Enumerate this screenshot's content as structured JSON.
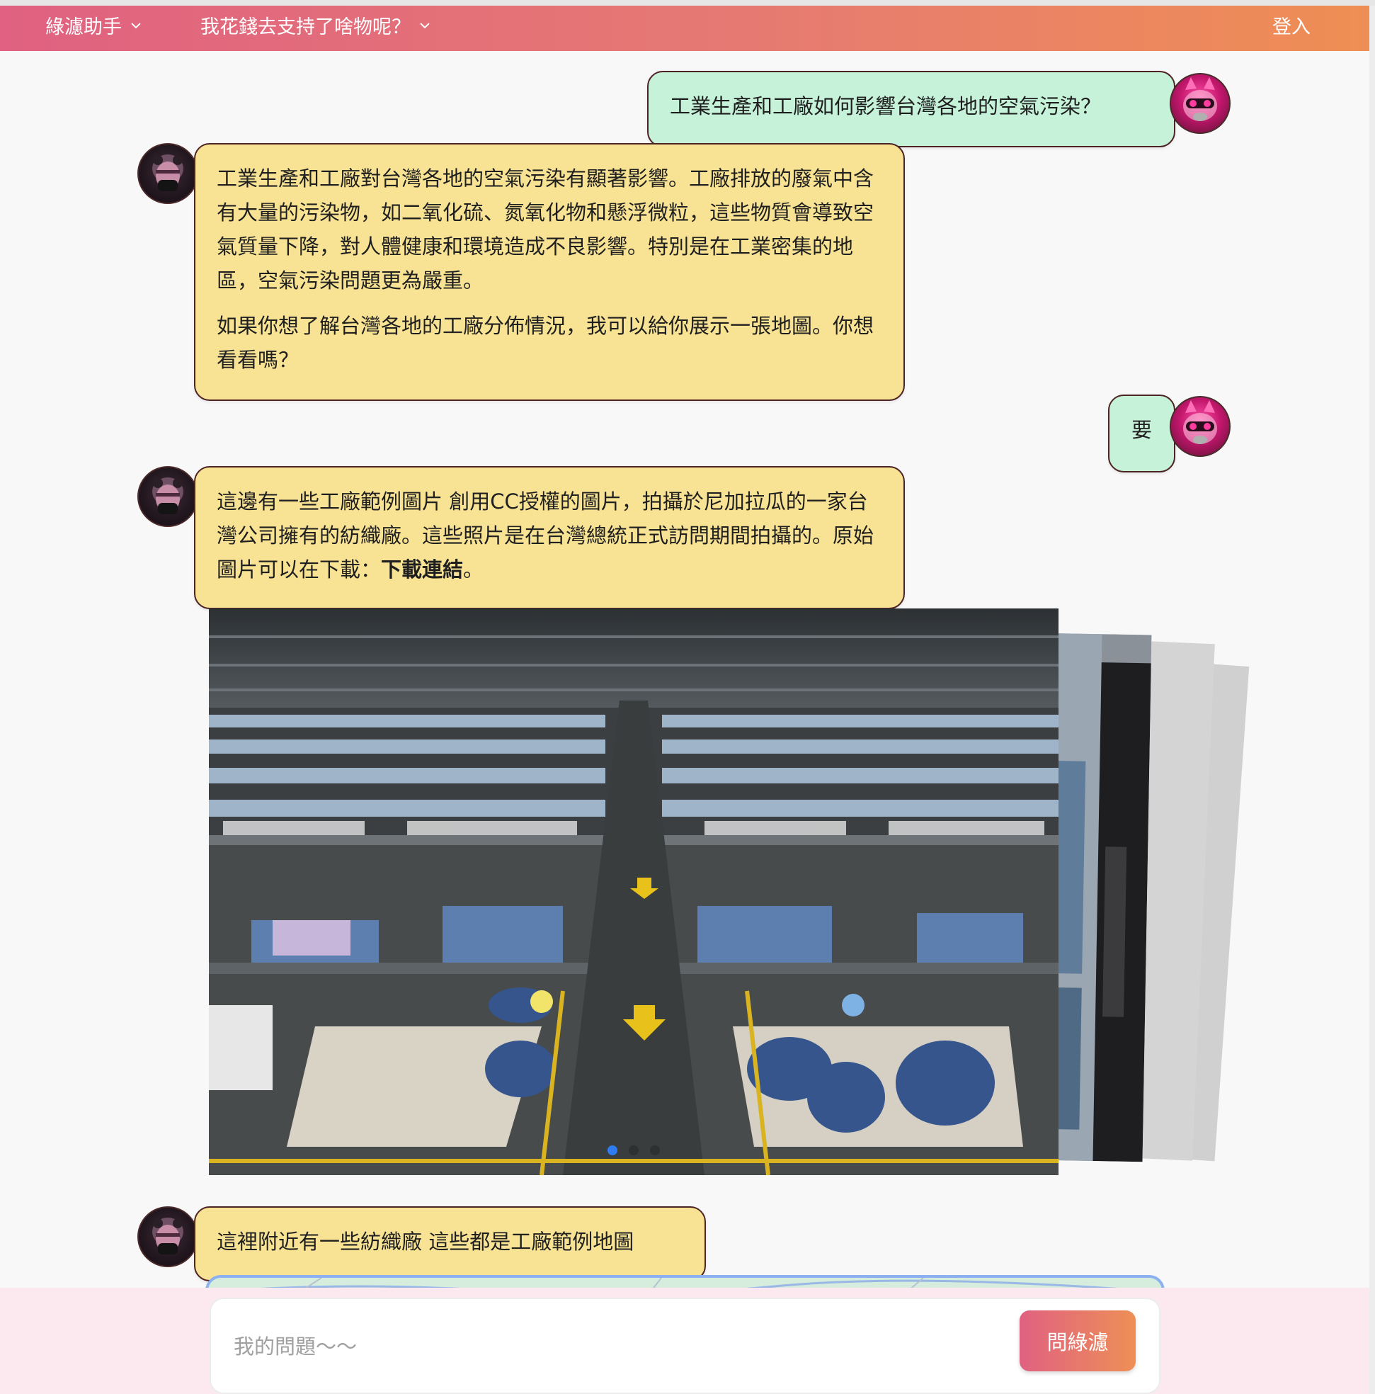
{
  "navbar": {
    "assistant_menu": "綠濾助手",
    "support_menu": "我花錢去支持了啥物呢？",
    "login": "登入"
  },
  "conversation": {
    "user_1": "工業生產和工廠如何影響台灣各地的空氣污染？",
    "bot_1_p1": "工業生產和工廠對台灣各地的空氣污染有顯著影響。工廠排放的廢氣中含有大量的污染物，如二氧化硫、氮氧化物和懸浮微粒，這些物質會導致空氣質量下降，對人體健康和環境造成不良影響。特別是在工業密集的地區，空氣污染問題更為嚴重。",
    "bot_1_p2": "如果你想了解台灣各地的工廠分佈情況，我可以給你展示一張地圖。你想看看嗎？",
    "user_2": "要",
    "bot_2_text": "這邊有一些工廠範例圖片 創用CC授權的圖片，拍攝於尼加拉瓜的一家台灣公司擁有的紡織廠。這些照片是在台灣總統正式訪問期間拍攝的。原始圖片可以在下載：",
    "bot_2_link": "下載連結",
    "bot_2_end": "。",
    "bot_3": "這裡附近有一些紡織廠 這些都是工廠範例地圖"
  },
  "carousel": {
    "slide_count": 3,
    "active_index": 0
  },
  "composer": {
    "placeholder": "我的問題～～",
    "value": "",
    "send_label": "問綠濾"
  },
  "colors": {
    "navbar_start": "#e06181",
    "navbar_end": "#ef8e54",
    "user_bubble": "#c6f2d9",
    "bot_bubble": "#f8e395",
    "bubble_border": "#4d2323",
    "active_dot": "#2f7cf2"
  },
  "icons": {
    "menu_chevron": "chevron-down-icon",
    "user_avatar": "user-avatar",
    "bot_avatar": "bot-avatar"
  }
}
